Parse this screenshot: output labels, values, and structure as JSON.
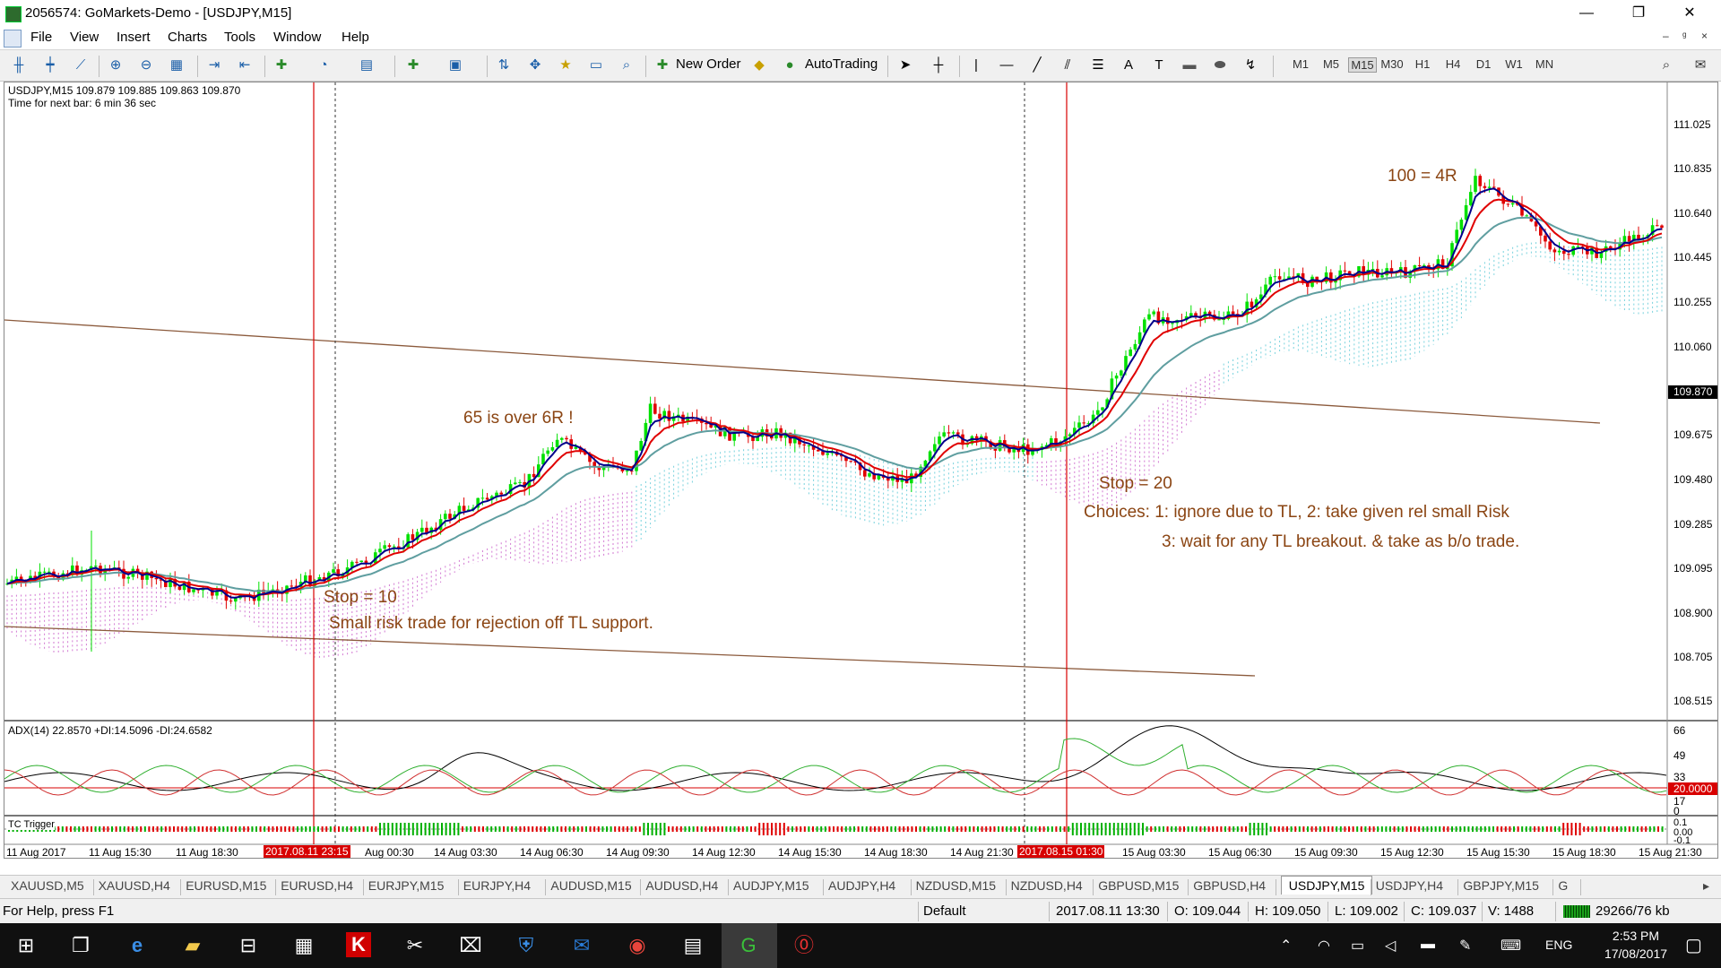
{
  "window": {
    "title": "2056574: GoMarkets-Demo - [USDJPY,M15]",
    "minimize": "—",
    "restore": "❐",
    "close": "✕",
    "mdi_minimize": "–",
    "mdi_restore": "ᵍ",
    "mdi_close": "×"
  },
  "menu": [
    "File",
    "View",
    "Insert",
    "Charts",
    "Tools",
    "Window",
    "Help"
  ],
  "toolbar": {
    "new_order": "New Order",
    "autotrading": "AutoTrading",
    "timeframes": [
      "M1",
      "M5",
      "M15",
      "M30",
      "H1",
      "H4",
      "D1",
      "W1",
      "MN"
    ],
    "active_timeframe": "M15"
  },
  "chart": {
    "header": "USDJPY,M15  109.879 109.885 109.863 109.870",
    "next_bar": "Time for next bar: 6 min 36 sec",
    "price_ticks": [
      "111.025",
      "110.835",
      "110.640",
      "110.445",
      "110.255",
      "110.060",
      "109.870",
      "109.675",
      "109.480",
      "109.285",
      "109.095",
      "108.900",
      "108.705",
      "108.515"
    ],
    "current_price": "109.870",
    "adx_label": "ADX(14) 22.8570 +DI:14.5096 -DI:24.6582",
    "adx_ticks": [
      "66",
      "49",
      "33",
      "17",
      "0"
    ],
    "adx_level": "20.0000",
    "tc_label": "TC Trigger",
    "tc_ticks": [
      "0.1",
      "0.00",
      "-0.1"
    ],
    "time_labels": [
      "11 Aug 2017",
      "11 Aug 15:30",
      "11 Aug 18:30",
      "2017.08.11 23:15",
      "Aug 00:30",
      "14 Aug 03:30",
      "14 Aug 06:30",
      "14 Aug 09:30",
      "14 Aug 12:30",
      "14 Aug 15:30",
      "14 Aug 18:30",
      "14 Aug 21:30",
      "2017.08.15 01:30",
      "15 Aug 03:30",
      "15 Aug 06:30",
      "15 Aug 09:30",
      "15 Aug 12:30",
      "15 Aug 15:30",
      "15 Aug 18:30",
      "15 Aug 21:30"
    ],
    "annotations": {
      "a1": "100 = 4R",
      "a2": "65 is over 6R !",
      "a3": "Stop = 20",
      "a4": "Choices: 1: ignore due to TL,  2: take given rel small Risk",
      "a5": "3: wait for any TL breakout. & take as b/o trade.",
      "a6": "Stop = 10",
      "a7": "Small risk trade for rejection off TL support."
    },
    "colors": {
      "bull": "#00e000",
      "bear": "#e00000",
      "ema_fast": "#00008b",
      "ema_mid": "#e00000",
      "ema_slow": "#5f9ea0",
      "trendline": "#8b5a3c",
      "cloud_up": "#40c0d0",
      "cloud_dn": "#c040c0"
    }
  },
  "tabs": [
    "XAUUSD,M5",
    "XAUUSD,H4",
    "EURUSD,M15",
    "EURUSD,H4",
    "EURJPY,M15",
    "EURJPY,H4",
    "AUDUSD,M15",
    "AUDUSD,H4",
    "AUDJPY,M15",
    "AUDJPY,H4",
    "NZDUSD,M15",
    "NZDUSD,H4",
    "GBPUSD,M15",
    "GBPUSD,H4",
    "USDJPY,M15",
    "USDJPY,H4",
    "GBPJPY,M15",
    "G"
  ],
  "active_tab": "USDJPY,M15",
  "status": {
    "help": "For Help, press F1",
    "profile": "Default",
    "time": "2017.08.11 13:30",
    "open": "O: 109.044",
    "high": "H: 109.050",
    "low": "L: 109.002",
    "close": "C: 109.037",
    "volume": "V: 1488",
    "traffic": "29266/76 kb"
  },
  "taskbar": {
    "lang": "ENG",
    "time": "2:53 PM",
    "date": "17/08/2017"
  }
}
